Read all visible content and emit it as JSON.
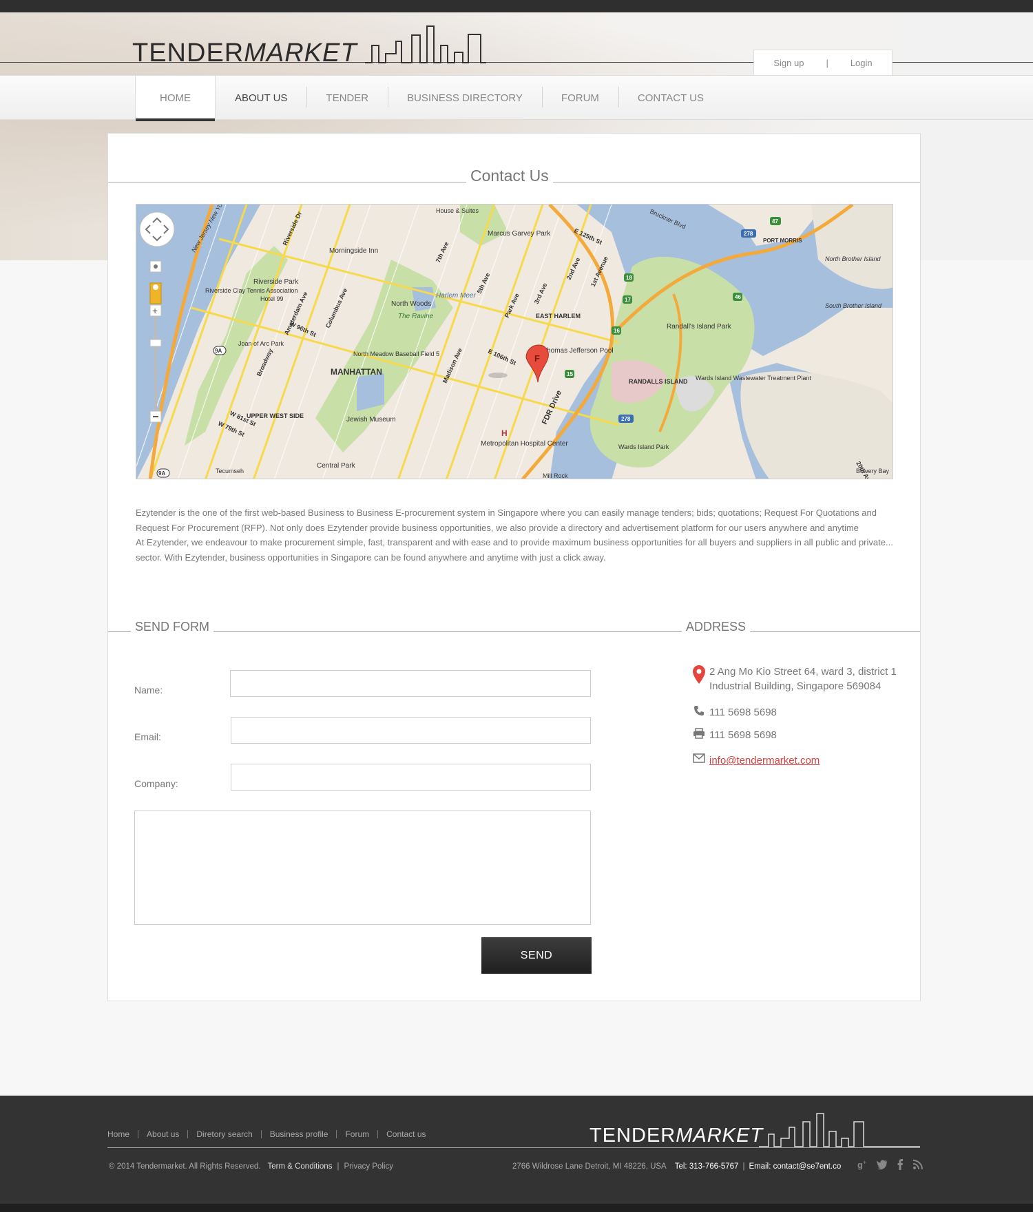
{
  "brand": {
    "part1": "TENDER",
    "part2": "MARKET"
  },
  "auth": {
    "signup": "Sign up",
    "separator": "|",
    "login": "Login"
  },
  "nav": {
    "items": [
      {
        "label": "HOME"
      },
      {
        "label": "ABOUT US"
      },
      {
        "label": "TENDER"
      },
      {
        "label": "BUSINESS DIRECTORY"
      },
      {
        "label": "FORUM"
      },
      {
        "label": "CONTACT US"
      }
    ]
  },
  "page": {
    "title": "Contact Us",
    "about": [
      "Ezytender is the one of the first web-based Business to Business E-procurement system in Singapore where you can easily manage tenders; bids; quotations; Request For Quotations and Request For Procurement (RFP). Not only does Ezytender provide business opportunities, we also provide a directory and advertisement platform for our users anywhere and anytime",
      "At Ezytender, we endeavour to make procurement simple, fast, transparent and with ease and to provide maximum business opportunities for all buyers and suppliers in all public and private... sector. With Ezytender, business opportunities in Singapore can be found anywhere and anytime with just a click away."
    ]
  },
  "map": {
    "labels": {
      "manhattan": "MANHATTAN",
      "east_harlem": "EAST HARLEM",
      "upper_west": "UPPER WEST SIDE",
      "north_woods": "North Woods",
      "the_ravine": "The Ravine",
      "harlem_meer": "Harlem Meer",
      "marcus": "Marcus Garvey Park",
      "morningside": "Morningside Inn",
      "riverside_park": "Riverside Park",
      "randalls": "Randall's Island Park",
      "randalls_island": "RANDALLS ISLAND",
      "wards_plant": "Wards Island Wastewater Treatment Plant",
      "wards_park": "Wards Island Park",
      "thomas": "Thomas Jefferson Pool",
      "jewish": "Jewish Museum",
      "metropolitan": "Metropolitan Hospital Center",
      "central_park": "Central Park",
      "port_morris": "PORT MORRIS",
      "north_brother": "North Brother Island",
      "south_brother": "South Brother Island",
      "north_meadow": "North Meadow Baseball Field 5",
      "riverside_tennis": "Riverside Clay Tennis Association",
      "hotel99": "Hotel 99",
      "joan": "Joan of Arc Park",
      "nj_ny": "New Jersey New York",
      "fdr": "FDR Drive",
      "tecumseh": "Tecumseh",
      "mill_rock": "Mill Rock",
      "bowery": "Bowery Bay",
      "bruckner": "Bruckner Blvd",
      "e125": "E 125th St",
      "e106": "E 106th St",
      "ave_1": "1st Avenue",
      "ave_2": "2nd Ave",
      "ave_3": "3rd Ave",
      "ave_5": "5th Ave",
      "ave_7": "7th Ave",
      "park_ave": "Park Ave",
      "madison": "Madison Ave",
      "amsterdam": "Amsterdam Ave",
      "columbus": "Columbus Ave",
      "broadway": "Broadway",
      "riverside_dr": "Riverside Dr",
      "w96": "W 96th St",
      "w81": "W 81st St",
      "w79": "W 79th St",
      "e20": "20th Av",
      "house_suites": "House & Suites",
      "marker": "F",
      "hospital": "H",
      "r278": "278",
      "r47": "47",
      "r17": "17",
      "r16": "16",
      "r15": "15",
      "r46": "46",
      "r18": "18",
      "r9a": "9A"
    }
  },
  "form": {
    "title": "SEND FORM",
    "name_label": "Name:",
    "email_label": "Email:",
    "company_label": "Company:",
    "name_value": "",
    "email_value": "",
    "company_value": "",
    "message_value": "",
    "send_label": "SEND"
  },
  "address": {
    "title": "ADDRESS",
    "line1": "2 Ang Mo Kio Street 64, ward 3, district 1",
    "line2": "Industrial Building, Singapore 569084",
    "phone": "111 5698 5698",
    "fax": "111 5698 5698",
    "email": "info@tendermarket.com"
  },
  "footer": {
    "links": [
      "Home",
      "About us",
      "Diretory search",
      "Business profile",
      "Forum",
      "Contact us"
    ],
    "copyright": "© 2014 Tendermarket.  All Rights Reserved.",
    "terms": "Term & Conditions",
    "pipe": "|",
    "privacy": "Privacy Policy",
    "address": "2766 Wildrose Lane Detroit, MI 48226, USA",
    "tel": "Tel: 313-766-5767",
    "email": "Email: contact@se7ent.co"
  },
  "colors": {
    "accent": "#d9413d",
    "dark": "#333333",
    "map_water": "#a5bfdd",
    "map_park": "#c8dfa8",
    "map_road": "#f7d94c"
  },
  "icons": [
    "location-pin-icon",
    "phone-icon",
    "fax-icon",
    "envelope-icon",
    "google-plus-icon",
    "twitter-icon",
    "facebook-icon",
    "rss-icon"
  ]
}
